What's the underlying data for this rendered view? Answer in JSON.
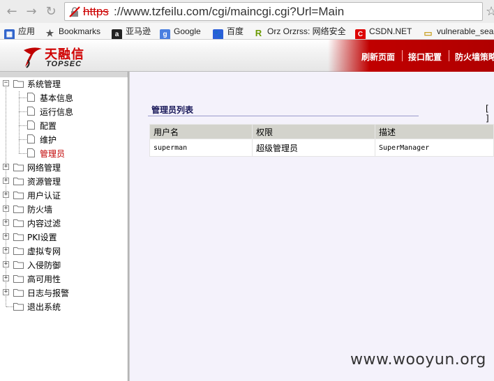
{
  "browser": {
    "url_scheme": "https",
    "url_rest": "://www.tzfeilu.com/cgi/maincgi.cgi?Url=Main",
    "bookmarks": [
      {
        "label": "应用",
        "icon": "apps-icon"
      },
      {
        "label": "Bookmarks",
        "icon": "star-icon"
      },
      {
        "label": "亚马逊",
        "icon": "amazon-icon"
      },
      {
        "label": "Google",
        "icon": "google-icon"
      },
      {
        "label": "百度",
        "icon": "baidu-icon"
      },
      {
        "label": "Orz Orzrss: 网络安全",
        "icon": "orzrss-icon"
      },
      {
        "label": "CSDN.NET",
        "icon": "csdn-icon"
      },
      {
        "label": "vulnerable_sea",
        "icon": "folder-icon"
      }
    ]
  },
  "app": {
    "logo_cn": "天融信",
    "logo_en": "TOPSEC",
    "nav": [
      "刷新页面",
      "接口配置",
      "防火墙策略"
    ],
    "accent": "#b40000"
  },
  "sidebar": {
    "root": {
      "label": "系统管理",
      "expanded": true
    },
    "children": [
      "基本信息",
      "运行信息",
      "配置",
      "维护",
      "管理员"
    ],
    "active_child": "管理员",
    "groups": [
      "网络管理",
      "资源管理",
      "用户认证",
      "防火墙",
      "内容过滤",
      "PKI设置",
      "虚拟专网",
      "入侵防御",
      "高可用性",
      "日志与报警"
    ],
    "logout": "退出系统"
  },
  "main": {
    "section_title": "管理员列表",
    "bracket": "[ ]",
    "table": {
      "headers": [
        "用户名",
        "权限",
        "描述"
      ],
      "rows": [
        [
          "superman",
          "超级管理员",
          "SuperManager"
        ]
      ]
    }
  },
  "watermark": "www.wooyun.org"
}
